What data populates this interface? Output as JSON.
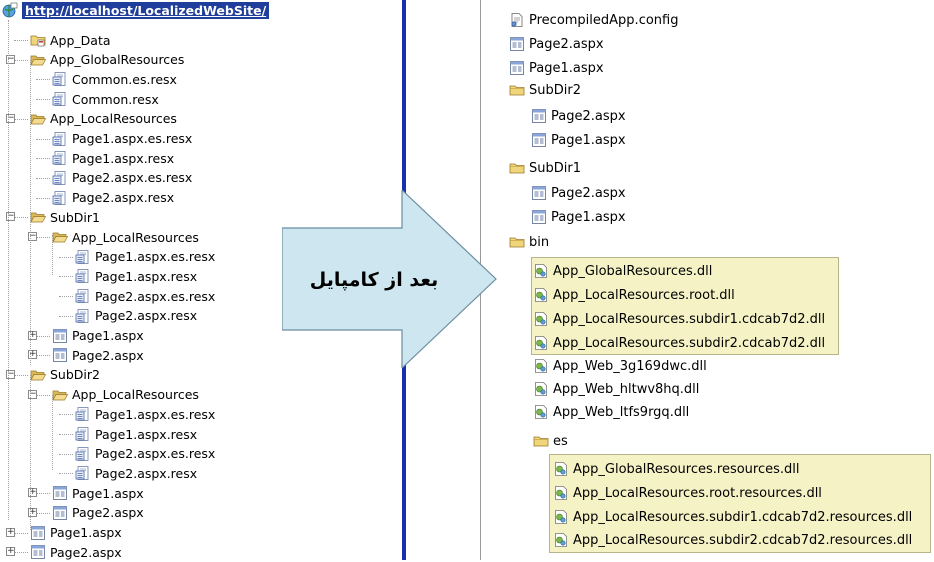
{
  "left_tree": {
    "root": "http://localhost/LocalizedWebSite/",
    "items": [
      {
        "label": "App_Data",
        "icon": "special-folder-icon",
        "depth": 1
      },
      {
        "label": "App_GlobalResources",
        "icon": "folder-open-icon",
        "depth": 1,
        "expander": "−"
      },
      {
        "label": "Common.es.resx",
        "icon": "resx-file-icon",
        "depth": 2
      },
      {
        "label": "Common.resx",
        "icon": "resx-file-icon",
        "depth": 2
      },
      {
        "label": "App_LocalResources",
        "icon": "folder-open-icon",
        "depth": 1,
        "expander": "−"
      },
      {
        "label": "Page1.aspx.es.resx",
        "icon": "resx-file-icon",
        "depth": 2
      },
      {
        "label": "Page1.aspx.resx",
        "icon": "resx-file-icon",
        "depth": 2
      },
      {
        "label": "Page2.aspx.es.resx",
        "icon": "resx-file-icon",
        "depth": 2
      },
      {
        "label": "Page2.aspx.resx",
        "icon": "resx-file-icon",
        "depth": 2
      },
      {
        "label": "SubDir1",
        "icon": "folder-open-icon",
        "depth": 1,
        "expander": "−"
      },
      {
        "label": "App_LocalResources",
        "icon": "folder-open-icon",
        "depth": 2,
        "expander": "−"
      },
      {
        "label": "Page1.aspx.es.resx",
        "icon": "resx-file-icon",
        "depth": 3
      },
      {
        "label": "Page1.aspx.resx",
        "icon": "resx-file-icon",
        "depth": 3
      },
      {
        "label": "Page2.aspx.es.resx",
        "icon": "resx-file-icon",
        "depth": 3
      },
      {
        "label": "Page2.aspx.resx",
        "icon": "resx-file-icon",
        "depth": 3
      },
      {
        "label": "Page1.aspx",
        "icon": "aspx-file-icon",
        "depth": 2,
        "expander": "+"
      },
      {
        "label": "Page2.aspx",
        "icon": "aspx-file-icon",
        "depth": 2,
        "expander": "+"
      },
      {
        "label": "SubDir2",
        "icon": "folder-open-icon",
        "depth": 1,
        "expander": "−"
      },
      {
        "label": "App_LocalResources",
        "icon": "folder-open-icon",
        "depth": 2,
        "expander": "−"
      },
      {
        "label": "Page1.aspx.es.resx",
        "icon": "resx-file-icon",
        "depth": 3
      },
      {
        "label": "Page1.aspx.resx",
        "icon": "resx-file-icon",
        "depth": 3
      },
      {
        "label": "Page2.aspx.es.resx",
        "icon": "resx-file-icon",
        "depth": 3
      },
      {
        "label": "Page2.aspx.resx",
        "icon": "resx-file-icon",
        "depth": 3
      },
      {
        "label": "Page1.aspx",
        "icon": "aspx-file-icon",
        "depth": 2,
        "expander": "+"
      },
      {
        "label": "Page2.aspx",
        "icon": "aspx-file-icon",
        "depth": 2,
        "expander": "+"
      },
      {
        "label": "Page1.aspx",
        "icon": "aspx-file-icon",
        "depth": 1,
        "expander": "+"
      },
      {
        "label": "Page2.aspx",
        "icon": "aspx-file-icon",
        "depth": 1,
        "expander": "+"
      }
    ]
  },
  "arrow": {
    "label": "بعد از کامپایل"
  },
  "right_tree": {
    "items": [
      {
        "label": "PrecompiledApp.config",
        "icon": "config-file-icon"
      },
      {
        "label": "Page2.aspx",
        "icon": "aspx-file-icon"
      },
      {
        "label": "Page1.aspx",
        "icon": "aspx-file-icon"
      },
      {
        "label": "SubDir2",
        "icon": "folder-closed-icon"
      },
      {
        "label": "Page2.aspx",
        "icon": "aspx-file-icon"
      },
      {
        "label": "Page1.aspx",
        "icon": "aspx-file-icon"
      },
      {
        "label": "SubDir1",
        "icon": "folder-closed-icon"
      },
      {
        "label": "Page2.aspx",
        "icon": "aspx-file-icon"
      },
      {
        "label": "Page1.aspx",
        "icon": "aspx-file-icon"
      },
      {
        "label": "bin",
        "icon": "folder-closed-icon"
      },
      {
        "label": "App_GlobalResources.dll",
        "icon": "dll-file-icon"
      },
      {
        "label": "App_LocalResources.root.dll",
        "icon": "dll-file-icon"
      },
      {
        "label": "App_LocalResources.subdir1.cdcab7d2.dll",
        "icon": "dll-file-icon"
      },
      {
        "label": "App_LocalResources.subdir2.cdcab7d2.dll",
        "icon": "dll-file-icon"
      },
      {
        "label": "App_Web_3g169dwc.dll",
        "icon": "dll-file-icon"
      },
      {
        "label": "App_Web_hltwv8hq.dll",
        "icon": "dll-file-icon"
      },
      {
        "label": "App_Web_ltfs9rgq.dll",
        "icon": "dll-file-icon"
      },
      {
        "label": "es",
        "icon": "folder-closed-icon"
      },
      {
        "label": "App_GlobalResources.resources.dll",
        "icon": "dll-file-icon"
      },
      {
        "label": "App_LocalResources.root.resources.dll",
        "icon": "dll-file-icon"
      },
      {
        "label": "App_LocalResources.subdir1.cdcab7d2.resources.dll",
        "icon": "dll-file-icon"
      },
      {
        "label": "App_LocalResources.subdir2.cdcab7d2.resources.dll",
        "icon": "dll-file-icon"
      }
    ]
  },
  "colors": {
    "highlight": "#f5f3c6",
    "divider": "#1a2fb0",
    "arrow_fill": "#cde6ef",
    "root_bg": "#1f3d9a"
  }
}
